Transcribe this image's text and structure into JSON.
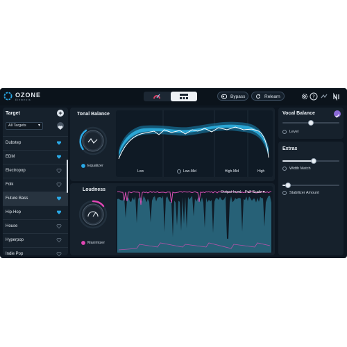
{
  "app": {
    "brand": "OZONE",
    "brand_sub": "Elements",
    "buttons": {
      "bypass": "Bypass",
      "relearn": "Relearn"
    }
  },
  "target": {
    "title": "Target",
    "dropdown": "All Targets",
    "items": [
      {
        "label": "Dubstep",
        "fav": true
      },
      {
        "label": "EDM",
        "fav": true
      },
      {
        "label": "Electropop",
        "fav": false
      },
      {
        "label": "Folk",
        "fav": false
      },
      {
        "label": "Future Bass",
        "fav": true,
        "selected": true
      },
      {
        "label": "Hip-Hop",
        "fav": true
      },
      {
        "label": "House",
        "fav": false
      },
      {
        "label": "Hyperpop",
        "fav": false
      },
      {
        "label": "Indie Pop",
        "fav": false
      }
    ]
  },
  "tonal": {
    "title": "Tonal Balance",
    "knob_label": "Equalizer",
    "bands": [
      "Low",
      "Low-Mid",
      "High-Mid",
      "High"
    ]
  },
  "loudness": {
    "title": "Loudness",
    "knob_label": "Maximizer",
    "output_label": "Output level:",
    "output_value": "Full Scale"
  },
  "vocal": {
    "title": "Vocal Balance",
    "slider_label": "Level",
    "level": 0.5
  },
  "extras": {
    "title": "Extras",
    "width": {
      "label": "Width Match",
      "value": 0.55
    },
    "stabilizer": {
      "label": "Stabilizer Amount",
      "value": 0.1
    }
  },
  "colors": {
    "accent_blue": "#2aa9e6",
    "accent_pink": "#e046b4",
    "accent_purple": "#8b6ad8",
    "panel_bg": "#16212c"
  }
}
